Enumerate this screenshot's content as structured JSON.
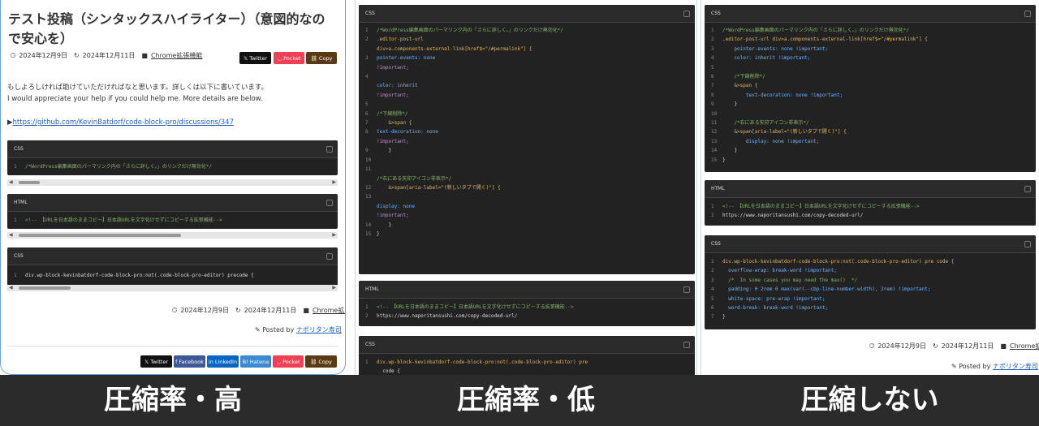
{
  "captions": [
    "圧縮率・高",
    "圧縮率・低",
    "圧縮しない"
  ],
  "panel1": {
    "title": "テスト投稿（シンタックスハイライター）（意図的なので安心を）",
    "published": "2024年12月9日",
    "updated": "2024年12月11日",
    "category": "Chrome拡張機能",
    "share_top": [
      "Twitter",
      "Pocket",
      "Copy"
    ],
    "body_ja": "もしよろしければ助けていただければなと思います。詳しくは以下に書いています。",
    "body_en": "I would appreciate your help if you could help me. More details are below.",
    "link_prefix": "▶",
    "link": "https://github.com/KevinBatdorf/code-block-pro/discussions/347",
    "code_blocks": [
      {
        "lang": "CSS",
        "lines": [
          {
            "n": "1",
            "t": "/*WordPress編集画面のパーマリンク内の「さらに詳しく。」のリンクだけ無効化*/"
          }
        ]
      },
      {
        "lang": "HTML",
        "lines": [
          {
            "n": "1",
            "t": "<!-- 【URLを日本語のままコピー】日本語URLを文字化けせずにコピーする拡張機能-->"
          }
        ]
      },
      {
        "lang": "CSS",
        "lines": [
          {
            "n": "1",
            "t": "div.wp-block-kevinbatdorf-code-block-pro:not(.code-block-pro-editor) precode {"
          }
        ]
      }
    ],
    "footer_published": "2024年12月9日",
    "footer_updated": "2024年12月11日",
    "footer_category": "Chrome拡張機能",
    "posted_by_label": "Posted by",
    "author": "ナポリタン寿司",
    "share_bottom": [
      "Twitter",
      "Facebook",
      "LinkedIn",
      "Hatena",
      "Pocket",
      "Copy"
    ]
  },
  "panel2": {
    "code_blocks": [
      {
        "lang": "CSS",
        "lines": [
          {
            "n": "1",
            "t": "/*WordPress編集画面のパーマリンク内の「さらに詳しく。」のリンクだけ無効化*/"
          },
          {
            "n": "2",
            "t": ".editor-post-url"
          },
          {
            "n": "",
            "t": "div>a.components-external-link[href$=\"/#permalink\"] {"
          },
          {
            "n": "",
            "t": ""
          },
          {
            "n": "3",
            "t": "pointer-events: none"
          },
          {
            "n": "",
            "t": "!important;"
          },
          {
            "n": "4",
            "t": ""
          },
          {
            "n": "",
            "t": "color: inherit"
          },
          {
            "n": "",
            "t": "!important;"
          },
          {
            "n": "5",
            "t": ""
          },
          {
            "n": "6",
            "t": "/*下線削除*/"
          },
          {
            "n": "7",
            "t": "    &>span {"
          },
          {
            "n": "8",
            "t": "text-decoration: none"
          },
          {
            "n": "",
            "t": "!important;"
          },
          {
            "n": "9",
            "t": "    }"
          },
          {
            "n": "10",
            "t": ""
          },
          {
            "n": "11",
            "t": ""
          },
          {
            "n": "",
            "t": "/*右にある矢印アイコン非表示*/"
          },
          {
            "n": "12",
            "t": "    &>span[aria-label=\"(新しいタブで開く)\"] {"
          },
          {
            "n": "13",
            "t": ""
          },
          {
            "n": "",
            "t": "display: none"
          },
          {
            "n": "",
            "t": "!important;"
          },
          {
            "n": "14",
            "t": "    }"
          },
          {
            "n": "15",
            "t": "}"
          }
        ]
      },
      {
        "lang": "HTML",
        "lines": [
          {
            "n": "1",
            "t": "<!-- 【URLを日本語のままコピー】日本語URLを文字化けせずにコピーする拡張機能-->"
          },
          {
            "n": "2",
            "t": "https://www.naporitansushi.com/copy-decoded-url/"
          }
        ]
      },
      {
        "lang": "CSS",
        "lines": [
          {
            "n": "1",
            "t": "div.wp-block-kevinbatdorf-code-block-pro:not(.code-block-pro-editor) pre"
          },
          {
            "n": "",
            "t": "  code {"
          }
        ]
      }
    ]
  },
  "panel3": {
    "code_blocks": [
      {
        "lang": "CSS",
        "lines": [
          {
            "n": "1",
            "t": "/*WordPress編集画面のパーマリンク内の「さらに詳しく。」のリンクだけ無効化*/"
          },
          {
            "n": "2",
            "t": ".editor-post-url div>a.components-external-link[href$=\"/#permalink\"] {"
          },
          {
            "n": "3",
            "t": "    pointer-events: none !important;"
          },
          {
            "n": "4",
            "t": "    color: inherit !important;"
          },
          {
            "n": "5",
            "t": ""
          },
          {
            "n": "6",
            "t": "    /*下線削除*/"
          },
          {
            "n": "7",
            "t": "    &>span {"
          },
          {
            "n": "8",
            "t": "        text-decoration: none !important;"
          },
          {
            "n": "9",
            "t": "    }"
          },
          {
            "n": "10",
            "t": ""
          },
          {
            "n": "11",
            "t": "    /*右にある矢印アイコン非表示*/"
          },
          {
            "n": "12",
            "t": "    &>span[aria-label=\"(新しいタブで開く)\"] {"
          },
          {
            "n": "13",
            "t": "        display: none !important;"
          },
          {
            "n": "14",
            "t": "    }"
          },
          {
            "n": "15",
            "t": "}"
          }
        ]
      },
      {
        "lang": "HTML",
        "lines": [
          {
            "n": "1",
            "t": "<!-- 【URLを日本語のままコピー】日本語URLを文字化けせずにコピーする拡張機能-->"
          },
          {
            "n": "2",
            "t": "https://www.naporitansushi.com/copy-decoded-url/"
          }
        ]
      },
      {
        "lang": "CSS",
        "lines": [
          {
            "n": "1",
            "t": "div.wp-block-kevinbatdorf-code-block-pro:not(.code-block-pro-editor) pre code {"
          },
          {
            "n": "2",
            "t": "  overflow-wrap: break-word !important;"
          },
          {
            "n": "3",
            "t": "  /*  In some cases you may need the max()  */"
          },
          {
            "n": "4",
            "t": "  padding: 0 2rem 0 max(var(--cbp-line-number-width), 2rem) !important;"
          },
          {
            "n": "5",
            "t": "  white-space: pre-wrap !important;"
          },
          {
            "n": "6",
            "t": "  word-break: break-word !important;"
          },
          {
            "n": "7",
            "t": "}"
          }
        ]
      }
    ],
    "footer_published": "2024年12月9日",
    "footer_updated": "2024年12月11日",
    "footer_category": "Chrome拡張機能",
    "posted_by_label": "Posted by",
    "author": "ナポリタン寿司"
  },
  "colors": {
    "twitter": "#111111",
    "facebook": "#3b5998",
    "linkedin": "#0a66c2",
    "hatena": "#3c8ad1",
    "pocket": "#ef4056",
    "copy": "#5a3a12",
    "code_bg": "#222222",
    "caption_bar": "#2b2b2b"
  }
}
